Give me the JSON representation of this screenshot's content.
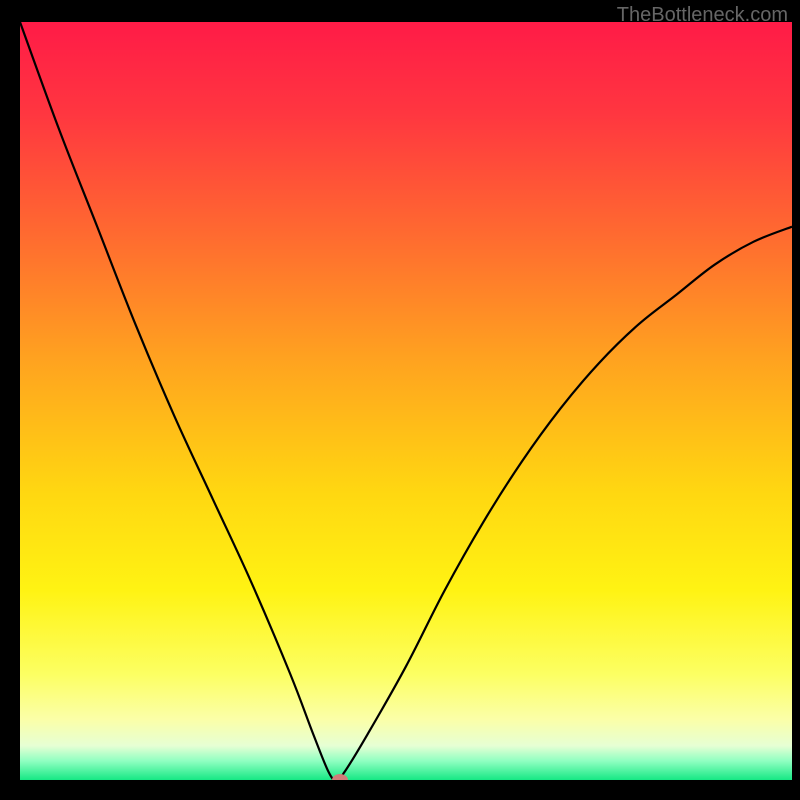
{
  "watermark": "TheBottleneck.com",
  "chart_data": {
    "type": "line",
    "title": "",
    "xlabel": "",
    "ylabel": "",
    "xlim": [
      0,
      100
    ],
    "ylim": [
      0,
      100
    ],
    "series": [
      {
        "name": "bottleneck-curve",
        "x": [
          0,
          5,
          10,
          15,
          20,
          25,
          30,
          35,
          38,
          40,
          41,
          42,
          45,
          50,
          55,
          60,
          65,
          70,
          75,
          80,
          85,
          90,
          95,
          100
        ],
        "y": [
          100,
          86,
          73,
          60,
          48,
          37,
          26,
          14,
          6,
          1,
          0,
          1,
          6,
          15,
          25,
          34,
          42,
          49,
          55,
          60,
          64,
          68,
          71,
          73
        ]
      }
    ],
    "marker": {
      "x": 41.5,
      "y": 0,
      "color": "#cf7d79"
    },
    "gradient_stops": [
      {
        "offset": 0.0,
        "color": "#ff1b47"
      },
      {
        "offset": 0.12,
        "color": "#ff3640"
      },
      {
        "offset": 0.28,
        "color": "#ff6a30"
      },
      {
        "offset": 0.45,
        "color": "#ffa41f"
      },
      {
        "offset": 0.62,
        "color": "#ffd711"
      },
      {
        "offset": 0.75,
        "color": "#fff313"
      },
      {
        "offset": 0.86,
        "color": "#fcff62"
      },
      {
        "offset": 0.92,
        "color": "#fbffa8"
      },
      {
        "offset": 0.955,
        "color": "#e6ffd4"
      },
      {
        "offset": 0.975,
        "color": "#8fffc1"
      },
      {
        "offset": 1.0,
        "color": "#16e884"
      }
    ]
  }
}
